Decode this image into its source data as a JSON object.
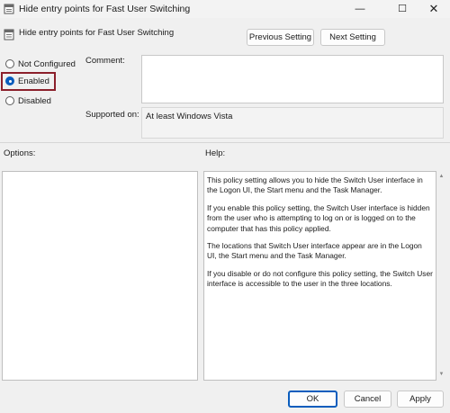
{
  "window": {
    "title": "Hide entry points for Fast User Switching",
    "minimize_glyph": "—",
    "maximize_glyph": "☐",
    "close_glyph": "✕"
  },
  "header": {
    "policy_title": "Hide entry points for Fast User Switching",
    "previous_label": "Previous Setting",
    "next_label": "Next Setting"
  },
  "state": {
    "options": [
      {
        "label": "Not Configured",
        "checked": false
      },
      {
        "label": "Enabled",
        "checked": true
      },
      {
        "label": "Disabled",
        "checked": false
      }
    ]
  },
  "comment": {
    "label": "Comment:",
    "value": ""
  },
  "supported": {
    "label": "Supported on:",
    "value": "At least Windows Vista"
  },
  "panels": {
    "options_label": "Options:",
    "help_label": "Help:"
  },
  "help_text": [
    "This policy setting allows you to hide the Switch User interface in the Logon UI, the Start menu and the Task Manager.",
    "If you enable this policy setting, the Switch User interface is hidden from the user who is attempting to log on or is logged on to the computer that has this policy applied.",
    "The locations that Switch User interface appear are in the Logon UI, the Start menu and the Task Manager.",
    "If you disable or do not configure this policy setting, the Switch User interface is accessible to the user in the three locations."
  ],
  "footer": {
    "ok_label": "OK",
    "cancel_label": "Cancel",
    "apply_label": "Apply"
  },
  "colors": {
    "accent": "#0a5dbd",
    "highlight_border": "#8b1f2b"
  },
  "icons": [
    "policy-icon",
    "minimize-icon",
    "maximize-icon",
    "close-icon",
    "scroll-up-icon",
    "scroll-down-icon"
  ]
}
